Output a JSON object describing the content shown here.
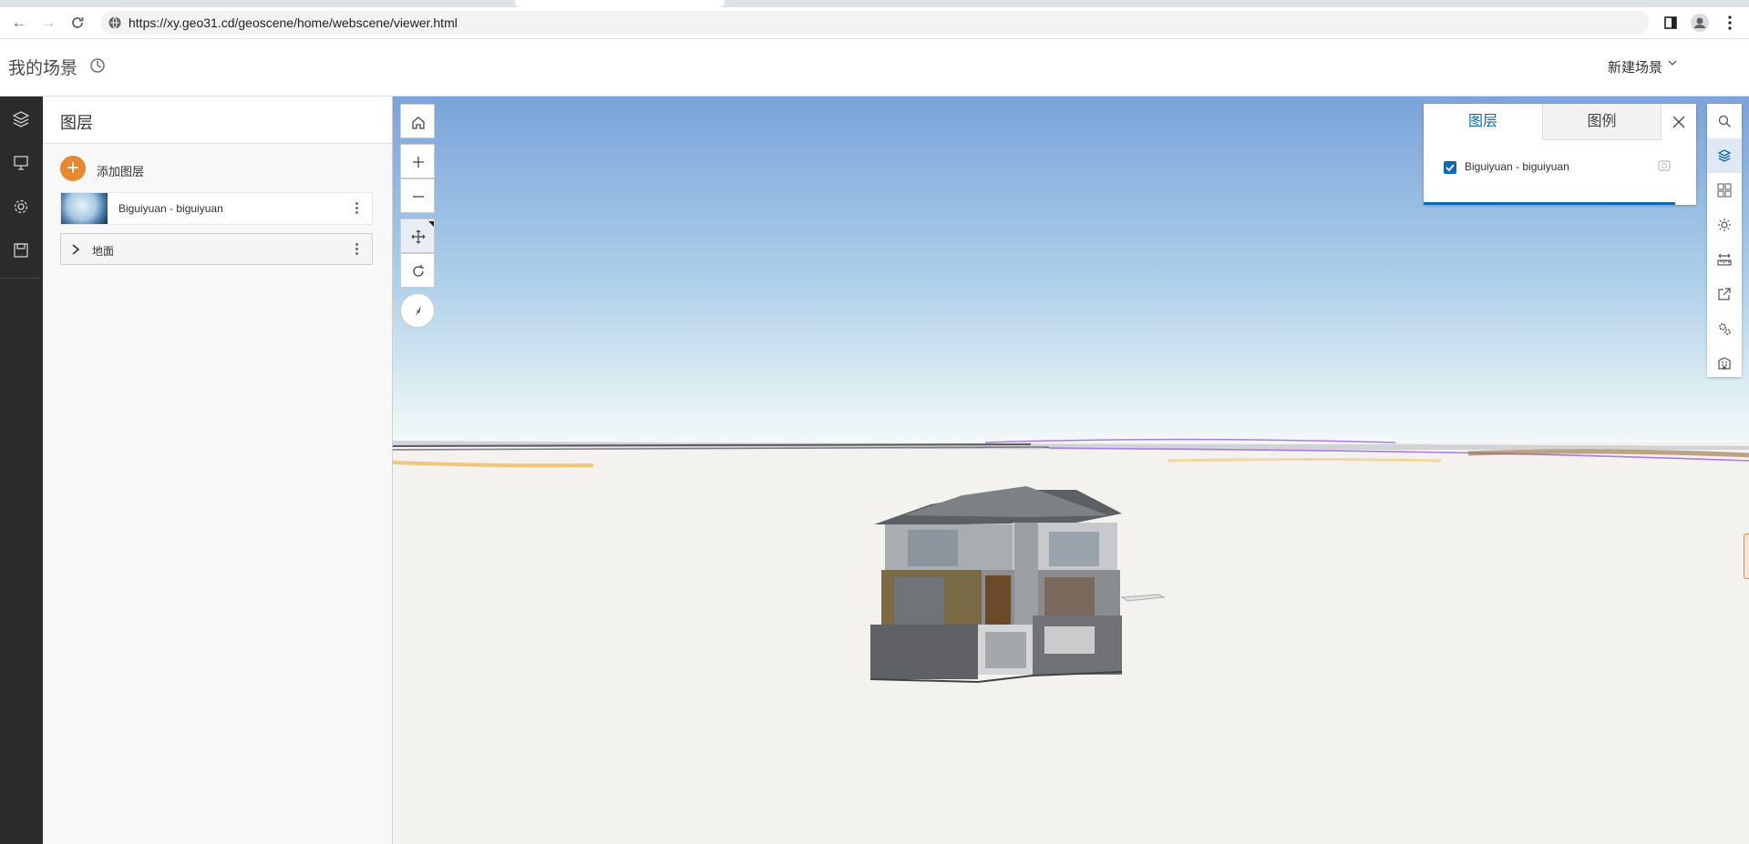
{
  "browser": {
    "url": "https://xy.geo31.cd/geoscene/home/webscene/viewer.html"
  },
  "header": {
    "title": "我的场景",
    "new_scene_label": "新建场景"
  },
  "rail": {
    "items": [
      "layers-icon",
      "presentation-icon",
      "settings-icon",
      "save-icon"
    ]
  },
  "layers_panel": {
    "title": "图层",
    "add_layer_label": "添加图层",
    "layers": [
      {
        "name": "Biguiyuan - biguiyuan"
      }
    ],
    "ground_label": "地面"
  },
  "layer_list_widget": {
    "tabs": [
      {
        "label": "图层",
        "selected": true
      },
      {
        "label": "图例",
        "selected": false
      }
    ],
    "items": [
      {
        "label": "Biguiyuan - biguiyuan",
        "checked": true
      }
    ]
  },
  "view_tools": [
    "home-icon",
    "zoom-in-icon",
    "zoom-out-icon",
    "pan-icon",
    "rotate-icon",
    "compass-icon"
  ],
  "right_toolbar": [
    "search-icon",
    "layers-icon",
    "basemap-icon",
    "daylight-icon",
    "measure-icon",
    "share-icon",
    "settings-icon",
    "building-icon"
  ],
  "colors": {
    "accent": "#0d6ab8",
    "add_button": "#e8892f",
    "rail_bg": "#2b2b2b"
  }
}
